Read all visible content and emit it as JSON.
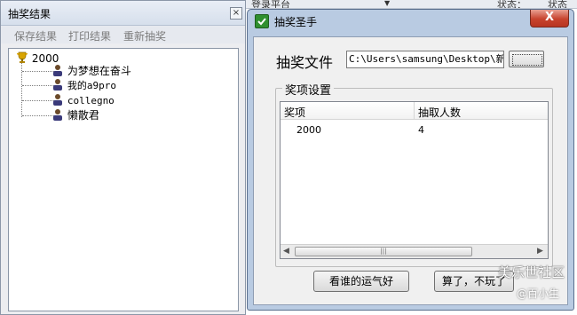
{
  "left_window": {
    "title": "抽奖结果",
    "close_label": "×",
    "menu": [
      "保存结果",
      "打印结果",
      "重新抽奖"
    ],
    "tree": {
      "root_label": "2000",
      "children": [
        "为梦想在奋斗",
        "我的a9pro",
        "collegno",
        "懒散君"
      ]
    }
  },
  "background_strip": {
    "left_text": "登录平台",
    "arrow": "▼",
    "right_text1": "状态：",
    "right_text2": "状态"
  },
  "dialog": {
    "title": "抽奖圣手",
    "close_label": "X",
    "file_label": "抽奖文件",
    "file_path": "C:\\Users\\samsung\\Desktop\\新建",
    "group_title": "奖项设置",
    "table": {
      "columns": [
        "奖项",
        "抽取人数"
      ],
      "rows": [
        [
          "2000",
          "4"
        ]
      ]
    },
    "scroll_left": "◀",
    "scroll_right": "▶",
    "scroll_grip": "|||",
    "button_lucky": "看谁的运气好",
    "button_quit": "算了，不玩了"
  },
  "watermark": {
    "line1": "美乐世社区",
    "line2": "@百小生"
  }
}
